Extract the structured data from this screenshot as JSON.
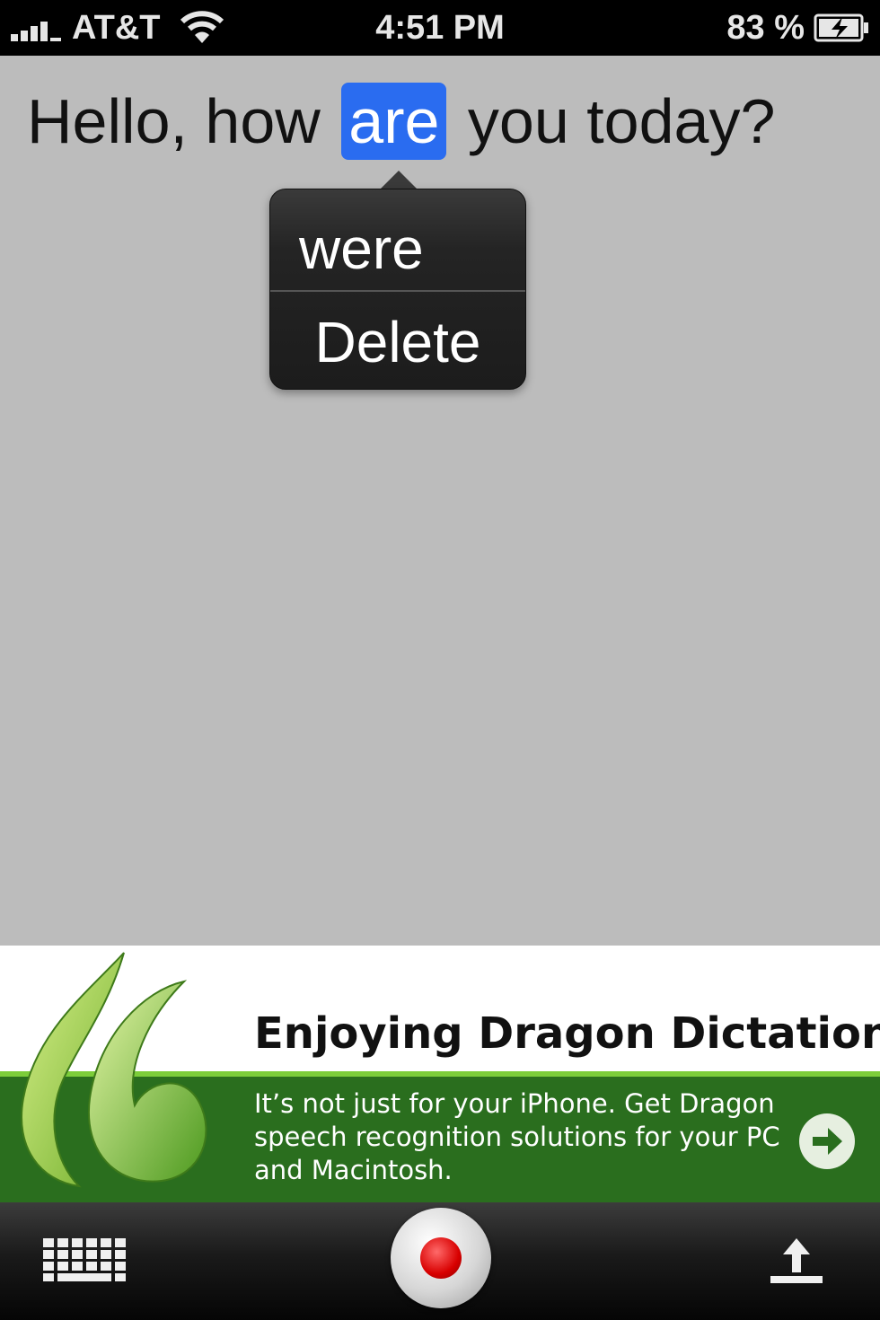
{
  "status_bar": {
    "carrier": "AT&T",
    "time": "4:51 PM",
    "battery": "83 %",
    "icons": [
      "signal-icon",
      "wifi-icon",
      "battery-charging-icon"
    ]
  },
  "dictation": {
    "before": "Hello, how",
    "selected": "are",
    "after": "you today?"
  },
  "popup": {
    "alternative": "were",
    "delete_label": "Delete"
  },
  "ad": {
    "headline": "Enjoying Dragon Dictation?",
    "body": "It’s not just for your iPhone. Get Dragon speech recognition solutions for your PC and Macintosh.",
    "icons": [
      "dragon-quote-logo",
      "arrow-right-icon"
    ]
  },
  "toolbar": {
    "icons": [
      "keyboard-icon",
      "record-icon",
      "share-upload-icon"
    ]
  },
  "colors": {
    "selection": "#2a6cf0",
    "ad_green": "#2a6e1e",
    "ad_stripe": "#7ccd3a",
    "record_red": "#d80000"
  }
}
